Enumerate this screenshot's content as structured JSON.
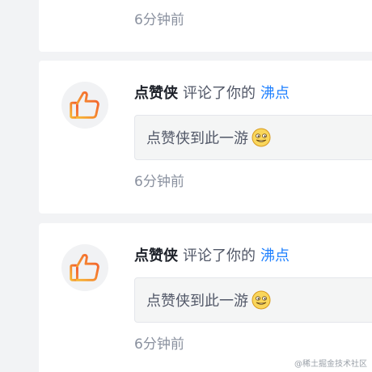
{
  "notifications": [
    {
      "time": "6分钟前"
    },
    {
      "avatar_icon": "thumbs-up-icon",
      "nickname": "点赞侠",
      "action": "评论了你的",
      "target": "沸点",
      "comment": "点赞侠到此一游",
      "emoji_icon": "grinning-emoji-icon",
      "time": "6分钟前"
    },
    {
      "avatar_icon": "thumbs-up-icon",
      "nickname": "点赞侠",
      "action": "评论了你的",
      "target": "沸点",
      "comment": "点赞侠到此一游",
      "emoji_icon": "grinning-emoji-icon",
      "time": "6分钟前"
    }
  ],
  "watermark": "@稀土掘金技术社区",
  "colors": {
    "page_bg": "#f2f3f5",
    "card_bg": "#ffffff",
    "link": "#1e80ff",
    "muted": "#8a919f",
    "text": "#1d2129"
  }
}
